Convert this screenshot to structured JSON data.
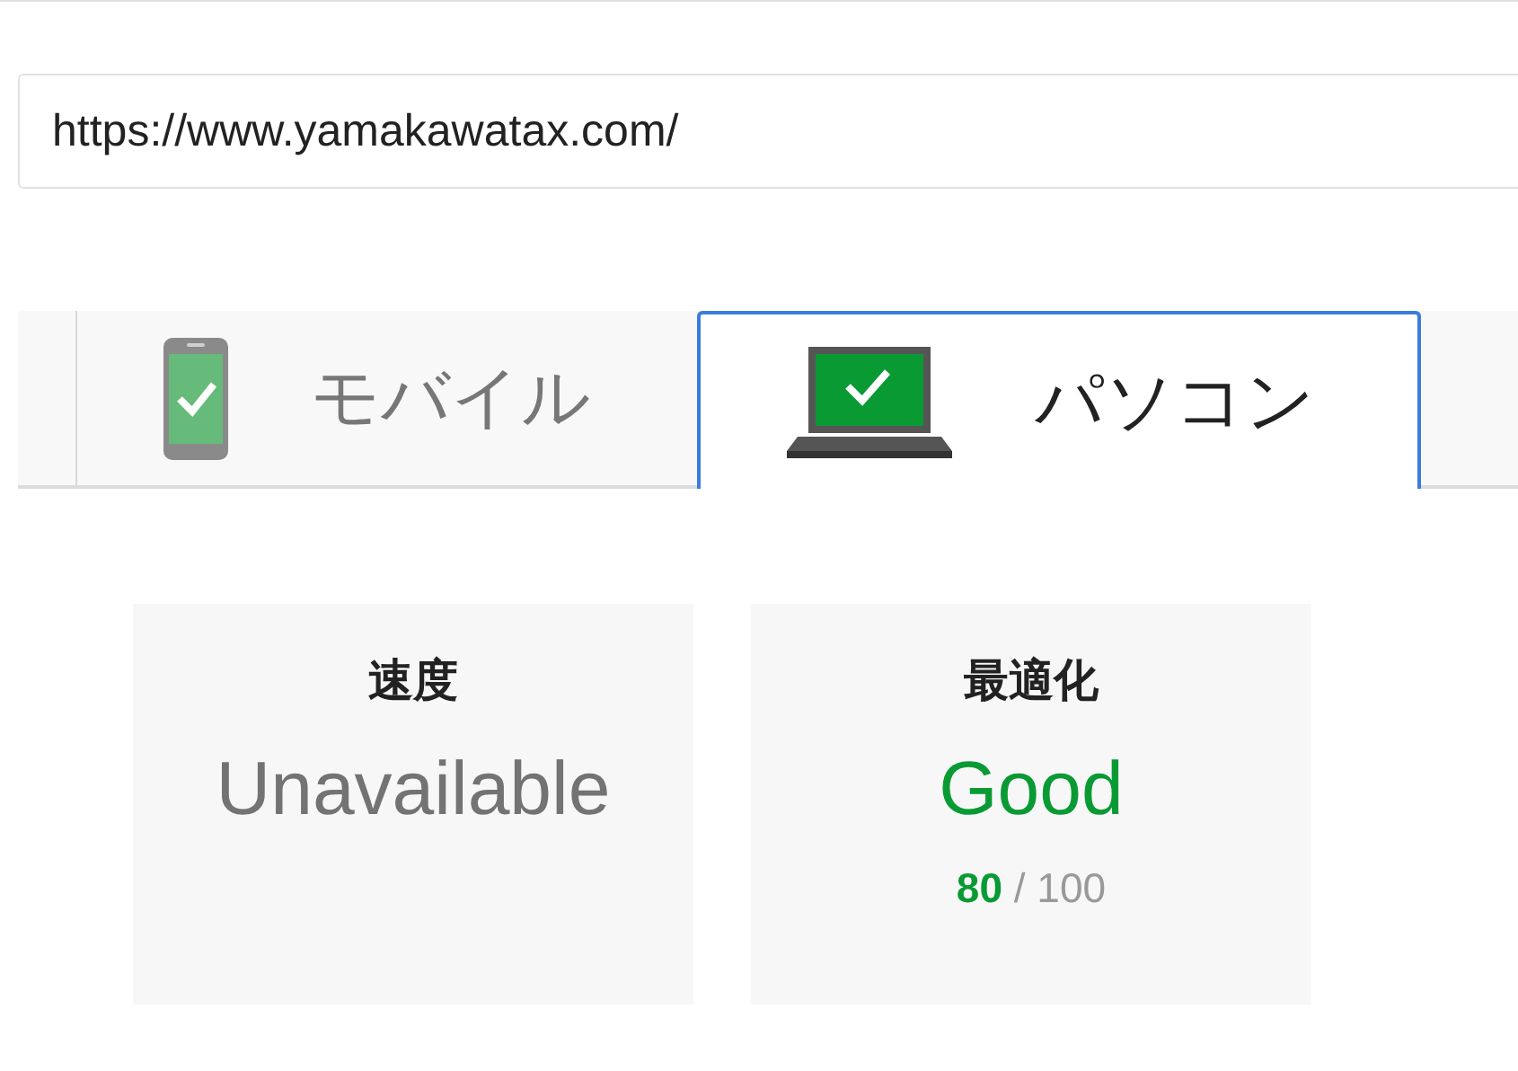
{
  "url_field": {
    "value": "https://www.yamakawatax.com/"
  },
  "tabs": [
    {
      "label": "モバイル",
      "kind": "mobile",
      "selected": false
    },
    {
      "label": "パソコン",
      "kind": "desktop",
      "selected": true
    }
  ],
  "cards": [
    {
      "title": "速度",
      "rating": "Unavailable",
      "kind": "unavailable"
    },
    {
      "title": "最適化",
      "rating": "Good",
      "kind": "good",
      "score": "**80** / 100"
    }
  ]
}
